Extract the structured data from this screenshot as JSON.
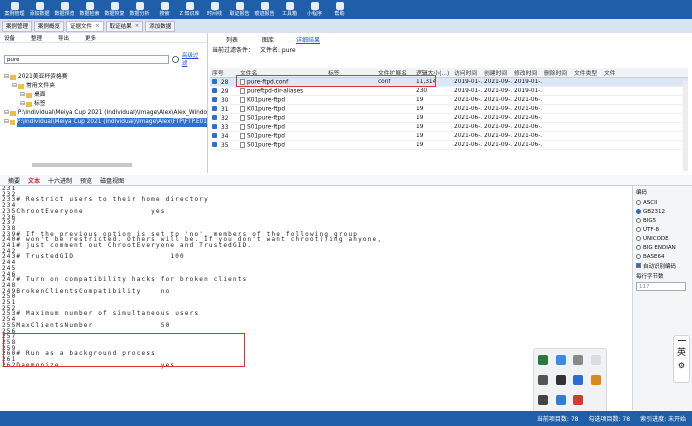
{
  "toolbar": {
    "items": [
      {
        "label": "案例管理",
        "icon": "case-icon"
      },
      {
        "label": "添加数据",
        "icon": "add-data-icon"
      },
      {
        "label": "数据预览",
        "icon": "preview-icon"
      },
      {
        "label": "数据检索",
        "icon": "search-data-icon"
      },
      {
        "label": "数据恢复",
        "icon": "recover-icon"
      },
      {
        "label": "数据分析",
        "icon": "analysis-icon"
      },
      {
        "label": "搜索",
        "icon": "search-icon"
      },
      {
        "label": "Z 知识库",
        "icon": "knowledge-icon"
      },
      {
        "label": "时间线",
        "icon": "timeline-icon"
      },
      {
        "label": "取证报告",
        "icon": "report-icon"
      },
      {
        "label": "痕迹报告",
        "icon": "trace-icon"
      },
      {
        "label": "工具箱",
        "icon": "toolbox-icon"
      },
      {
        "label": "小程序",
        "icon": "miniapp-icon"
      },
      {
        "label": "帮助",
        "icon": "help-icon"
      }
    ]
  },
  "tabs": [
    {
      "label": "案例管理",
      "active": false,
      "closable": false
    },
    {
      "label": "案例概览",
      "active": false,
      "closable": false
    },
    {
      "label": "证据文件",
      "active": true,
      "closable": true
    },
    {
      "label": "取证结果",
      "active": false,
      "closable": true
    },
    {
      "label": "添加数据",
      "active": false,
      "closable": false
    }
  ],
  "left_panel": {
    "toolbar": [
      "设备",
      "整理",
      "导出",
      "更多"
    ],
    "search_value": "pure",
    "advanced_link": "高级过滤",
    "tree": [
      {
        "label": "2021美亚杯资格赛",
        "level": 0,
        "selected": false
      },
      {
        "label": "常用文件夹",
        "level": 1,
        "selected": false
      },
      {
        "label": "桌面",
        "level": 2,
        "selected": false
      },
      {
        "label": "标签",
        "level": 2,
        "selected": false
      },
      {
        "label": "P:\\Individual\\Meiya Cup 2021 (Individual)\\Image\\Alex\\Alex_Windo",
        "level": 0,
        "selected": false
      },
      {
        "label": "P:\\Individual\\Meiya Cup 2021 (Individual)\\Image\\Alex\\FTP\\FTP.E01",
        "level": 0,
        "selected": true
      }
    ]
  },
  "right_panel": {
    "view_tabs": [
      "列表",
      "图库",
      "详细结果"
    ],
    "active_view": "详细结果",
    "filter_label": "当前过滤条件：",
    "filter_value": "文件名: pure",
    "columns": [
      "序号",
      "文件名",
      "标签",
      "文件扩展名",
      "逻辑大小(...)",
      "访问时间",
      "创建时间",
      "修改时间",
      "删除时间",
      "文件类型",
      "文件"
    ],
    "rows": [
      {
        "num": "28",
        "name": "pure-ftpd.conf",
        "ext": "conf",
        "size": "11,314",
        "access": "2019-01-...",
        "create": "2021-09-...",
        "modify": "2019-01-...",
        "highlight": true
      },
      {
        "num": "29",
        "name": "pureftpd-dir-aliases",
        "ext": "",
        "size": "230",
        "access": "2019-01-...",
        "create": "2021-09-...",
        "modify": "2019-01-...",
        "highlight": false
      },
      {
        "num": "30",
        "name": "K01pure-ftpd",
        "ext": "",
        "size": "19",
        "access": "2021-06-...",
        "create": "2021-09-...",
        "modify": "2021-06-...",
        "highlight": false
      },
      {
        "num": "31",
        "name": "K01pure-ftpd",
        "ext": "",
        "size": "19",
        "access": "2021-06-...",
        "create": "2021-09-...",
        "modify": "2021-06-...",
        "highlight": false
      },
      {
        "num": "32",
        "name": "S01pure-ftpd",
        "ext": "",
        "size": "19",
        "access": "2021-06-...",
        "create": "2021-09-...",
        "modify": "2021-06-...",
        "highlight": false
      },
      {
        "num": "33",
        "name": "S01pure-ftpd",
        "ext": "",
        "size": "19",
        "access": "2021-06-...",
        "create": "2021-09-...",
        "modify": "2021-06-...",
        "highlight": false
      },
      {
        "num": "34",
        "name": "S01pure-ftpd",
        "ext": "",
        "size": "19",
        "access": "2021-06-...",
        "create": "2021-09-...",
        "modify": "2021-06-...",
        "highlight": false
      },
      {
        "num": "35",
        "name": "S01pure-ftpd",
        "ext": "",
        "size": "19",
        "access": "2021-06-...",
        "create": "2021-09-...",
        "modify": "2021-06-...",
        "highlight": false
      }
    ]
  },
  "bottom_tabs": [
    "摘要",
    "文本",
    "十六进制",
    "预览",
    "磁盘视图"
  ],
  "active_bottom_tab": "文本",
  "text_lines": [
    "231",
    "232",
    "233# Restrict users to their home directory",
    "234",
    "235ChrootEveryone              yes",
    "236",
    "237",
    "238",
    "239# If the previous option is set to 'no', members of the following group",
    "240# won't be restricted. Others will be. If you don't want chroot()ing anyone,",
    "241# just comment out ChrootEveryone and TrustedGID.",
    "242",
    "243# TrustedGID                    100",
    "244",
    "245",
    "246",
    "247# Turn on compatibility hacks for broken clients",
    "248",
    "249BrokenClientsCompatibility    no",
    "250",
    "251",
    "252",
    "253# Maximum number of simultaneous users",
    "254",
    "255MaxClientsNumber              50",
    "256",
    "257",
    "258",
    "259",
    "260# Run as a background process",
    "261",
    "262Daemonize                     yes"
  ],
  "encoding_panel": {
    "title": "编码",
    "options": [
      "ASCII",
      "GB2312",
      "BIG5",
      "UTF-8",
      "UNICODE",
      "BIG ENDIAN",
      "BASE64"
    ],
    "selected": "GB2312",
    "auto_detect": "自动识别编码",
    "bytes_label": "每行字节数",
    "bytes_value": "117"
  },
  "ime": {
    "label": "英"
  },
  "status": {
    "items": [
      "当前项目数: 78",
      "勾选项目数: 78",
      "索引进度: 未开始"
    ]
  }
}
